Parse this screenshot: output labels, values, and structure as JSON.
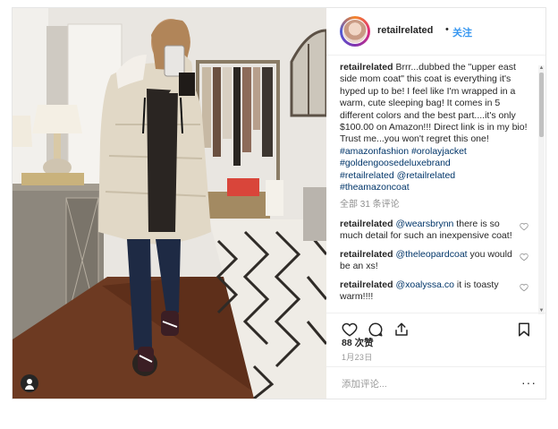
{
  "post": {
    "username": "retailrelated",
    "follow_label": "关注",
    "separator": "•",
    "caption": {
      "username": "retailrelated",
      "text": "Brrr...dubbed the \"upper east side mom coat\" this coat is everything it's hyped up to be! I feel like I'm wrapped in a warm, cute sleeping bag! It comes in 5 different colors and the best part....it's only $100.00 on Amazon!!! Direct link is in my bio! Trust me...you won't regret this one!",
      "hashtags_line1": "#amazonfashion #orolayjacket",
      "hashtags_line2": "#goldengoosedeluxebrand",
      "hashtags_line3": "#retailrelated @retailrelated",
      "hashtags_line4": "#theamazoncoat"
    },
    "view_all_comments": "全部 31 条评论",
    "comments": [
      {
        "user": "retailrelated",
        "mention": "@wearsbrynn",
        "text": " there is so much detail for such an inexpensive coat!"
      },
      {
        "user": "retailrelated",
        "mention": "@theleopardcoat",
        "text": " you would be an xs!"
      },
      {
        "user": "retailrelated",
        "mention": "@xoalyssa.co",
        "text": " it is toasty warm!!!!"
      }
    ],
    "likes": "88 次赞",
    "date": "1月23日",
    "add_comment_placeholder": "添加评论...",
    "more_label": "···"
  },
  "icons": {
    "like": "heart-icon",
    "comment": "comment-icon",
    "share": "share-icon",
    "save": "bookmark-icon",
    "tagged_user": "user-tag-icon"
  },
  "colors": {
    "link": "#3897f0",
    "hashtag": "#003569",
    "muted": "#8e8e8e",
    "border": "#efefef"
  }
}
